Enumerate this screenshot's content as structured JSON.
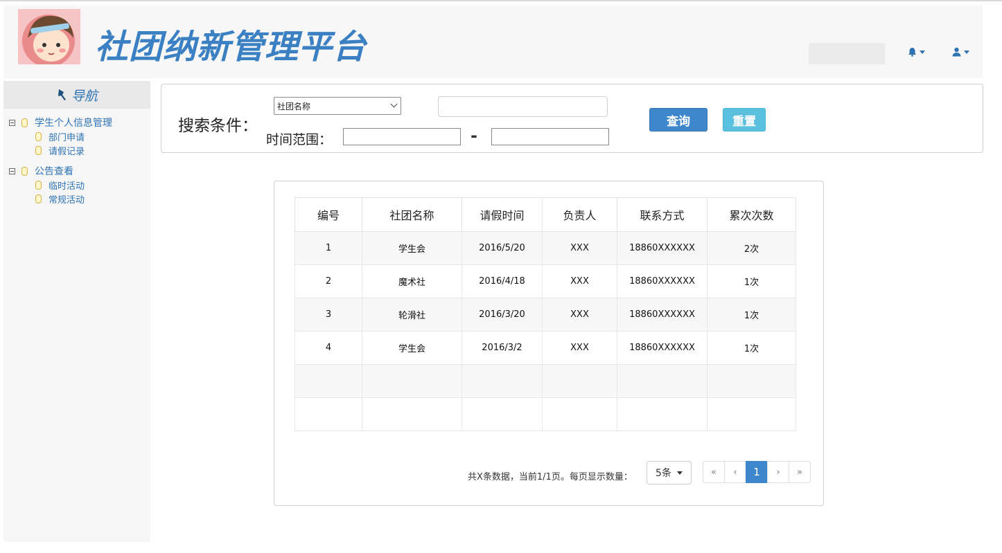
{
  "header": {
    "title": "社团纳新管理平台",
    "notification_icon": "bell-icon",
    "user_icon": "user-icon",
    "brand_color": "#3a80c2"
  },
  "sidebar": {
    "title": "导航",
    "groups": [
      {
        "label": "学生个人信息管理",
        "items": [
          {
            "label": "部门申请"
          },
          {
            "label": "请假记录"
          }
        ]
      },
      {
        "label": "公告查看",
        "items": [
          {
            "label": "临时活动"
          },
          {
            "label": "常规活动"
          }
        ]
      }
    ]
  },
  "search": {
    "label": "搜索条件：",
    "select_value": "社团名称",
    "keyword_value": "",
    "time_label": "时间范围：",
    "start_value": "",
    "end_value": "",
    "separator": "-",
    "query_button": "查询",
    "reset_button": "重置"
  },
  "table": {
    "columns": [
      "编号",
      "社团名称",
      "请假时间",
      "负责人",
      "联系方式",
      "累次次数"
    ],
    "rows": [
      [
        "1",
        "学生会",
        "2016/5/20",
        "XXX",
        "18860XXXXXX",
        "2次"
      ],
      [
        "2",
        "魔术社",
        "2016/4/18",
        "XXX",
        "18860XXXXXX",
        "1次"
      ],
      [
        "3",
        "轮滑社",
        "2016/3/20",
        "XXX",
        "18860XXXXXX",
        "1次"
      ],
      [
        "4",
        "学生会",
        "2016/3/2",
        "XXX",
        "18860XXXXXX",
        "1次"
      ]
    ],
    "empty_rows": 2
  },
  "pagination": {
    "summary": "共X条数据，当前1/1页。每页显示数量：",
    "page_size": "5条",
    "first": "«",
    "prev": "‹",
    "current": "1",
    "next": "›",
    "last": "»",
    "accent": "#3f87cc"
  }
}
